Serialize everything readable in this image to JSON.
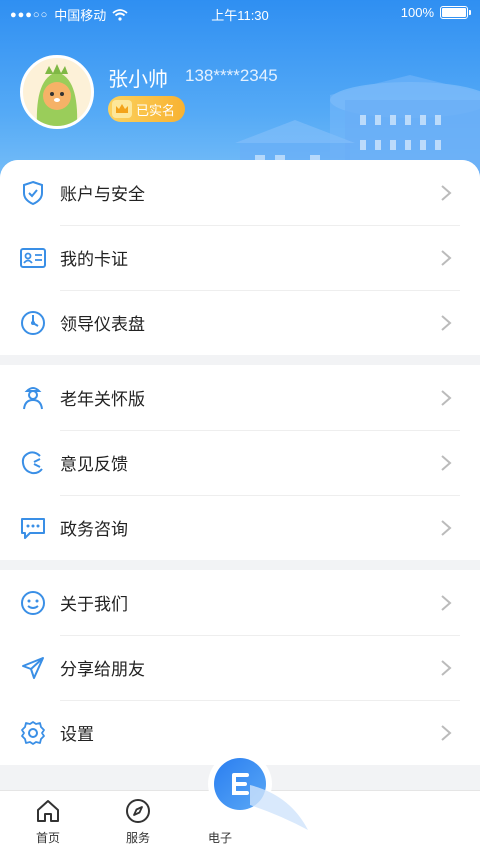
{
  "status_bar": {
    "carrier": "中国移动",
    "time": "上午11:30",
    "battery": "100%"
  },
  "profile": {
    "name": "张小帅",
    "phone": "138****2345",
    "badge": "已实名"
  },
  "menu_groups": [
    [
      {
        "label": "账户与安全",
        "icon": "shield-check-icon"
      },
      {
        "label": "我的卡证",
        "icon": "id-card-icon"
      },
      {
        "label": "领导仪表盘",
        "icon": "dashboard-icon"
      }
    ],
    [
      {
        "label": "老年关怀版",
        "icon": "elder-user-icon"
      },
      {
        "label": "意见反馈",
        "icon": "feedback-icon"
      },
      {
        "label": "政务咨询",
        "icon": "chat-bubble-icon"
      }
    ],
    [
      {
        "label": "关于我们",
        "icon": "smile-icon"
      },
      {
        "label": "分享给朋友",
        "icon": "share-send-icon"
      },
      {
        "label": "设置",
        "icon": "gear-icon"
      }
    ]
  ],
  "tabs": [
    {
      "label": "首页",
      "icon": "home-icon"
    },
    {
      "label": "服务",
      "icon": "compass-icon"
    },
    {
      "label": "电子",
      "icon": "e-card-icon"
    }
  ],
  "colors": {
    "accent": "#2f8ff2",
    "badge": "#f8b232",
    "icon_blue": "#3a8fe6"
  }
}
